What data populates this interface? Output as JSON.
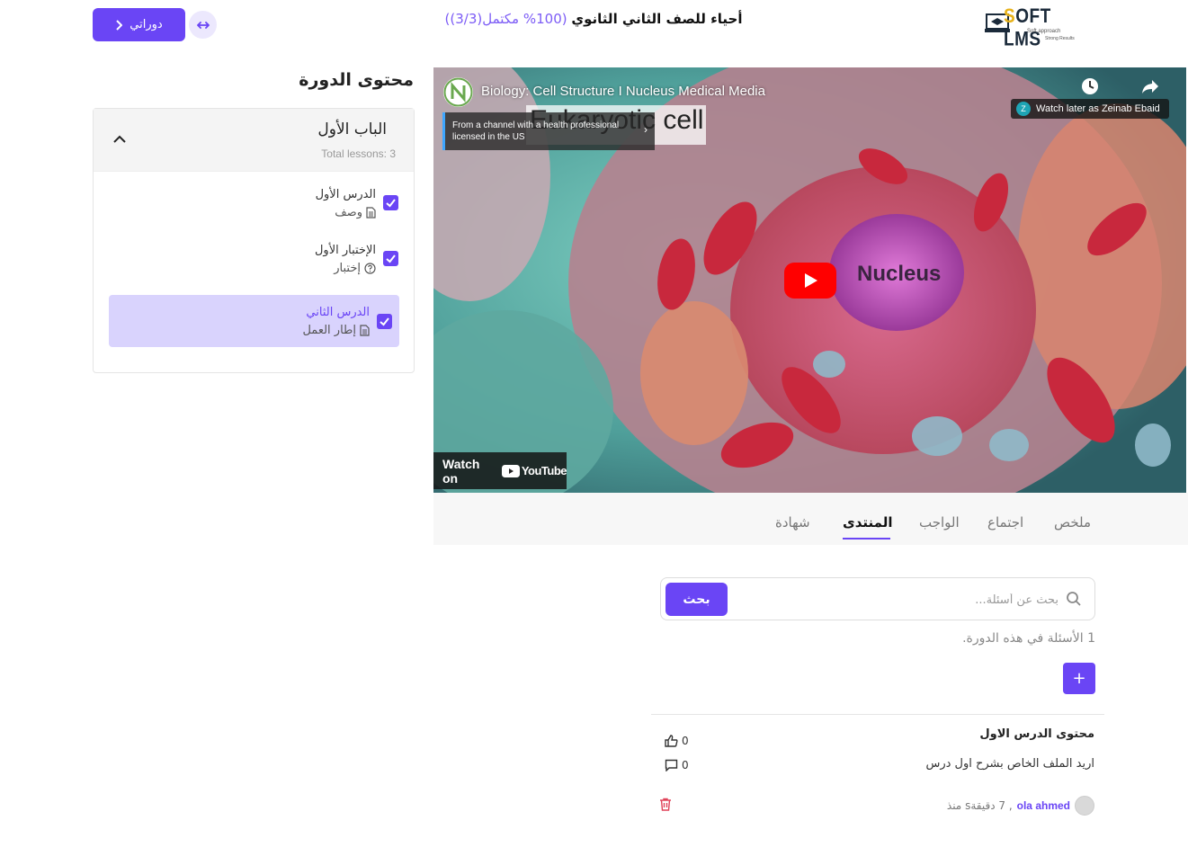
{
  "header": {
    "logo_text": "SOFT LMS",
    "logo_tagline_1": "Soft approach",
    "logo_tagline_2": "Strong Results",
    "course_name": "أحياء للصف الثاني الثانوي",
    "course_progress": "(100% مكتمل(3/3))",
    "my_courses_label": "دوراتي",
    "expand_icon": "arrows-horizontal-icon"
  },
  "sidebar": {
    "title": "محتوى الدورة",
    "chapter": {
      "title": "الباب الأول",
      "total": "Total lessons: 3",
      "toggle_icon": "chevron-up-icon"
    },
    "lessons": [
      {
        "title": "الدرس الأول",
        "type": "وصف",
        "icon": "document-icon",
        "completed": true,
        "active": false
      },
      {
        "title": "الإختبار الأول",
        "type": "إختبار",
        "icon": "question-circle-icon",
        "completed": true,
        "active": false
      },
      {
        "title": "الدرس الثاني",
        "type": "إطار العمل",
        "icon": "document-icon",
        "completed": true,
        "active": true
      }
    ]
  },
  "video": {
    "title": "Biology: Cell Structure I Nucleus Medical Media",
    "channel_info": "From a channel with a health professional licensed in the US",
    "overlay_text": "Eukaryotic cell",
    "watch_later": "Watch later as Zeinab Ebaid",
    "watch_later_initial": "Z",
    "nucleus_label": "Nucleus",
    "watch_on": "Watch on",
    "youtube": "YouTube"
  },
  "tabs": [
    {
      "label": "ملخص",
      "active": false
    },
    {
      "label": "اجتماع",
      "active": false
    },
    {
      "label": "الواجب",
      "active": false
    },
    {
      "label": "المنتدى",
      "active": true
    },
    {
      "label": "شهادة",
      "active": false
    }
  ],
  "forum": {
    "search_placeholder": "بحث عن أسئلة...",
    "search_button": "بحث",
    "questions_count": "1 الأسئلة في هذه الدورة.",
    "add_button": "+",
    "question": {
      "title": "محتوى الدرس الاول",
      "body": "اريد الملف الخاص بشرح اول درس",
      "likes": "0",
      "comments": "0",
      "author": "ola ahmed",
      "time": ", 7 دقيقةs منذ"
    }
  },
  "colors": {
    "accent": "#6a45f5",
    "active_lesson_bg": "#d9d3fd",
    "progress_text": "#7c5cf6"
  }
}
